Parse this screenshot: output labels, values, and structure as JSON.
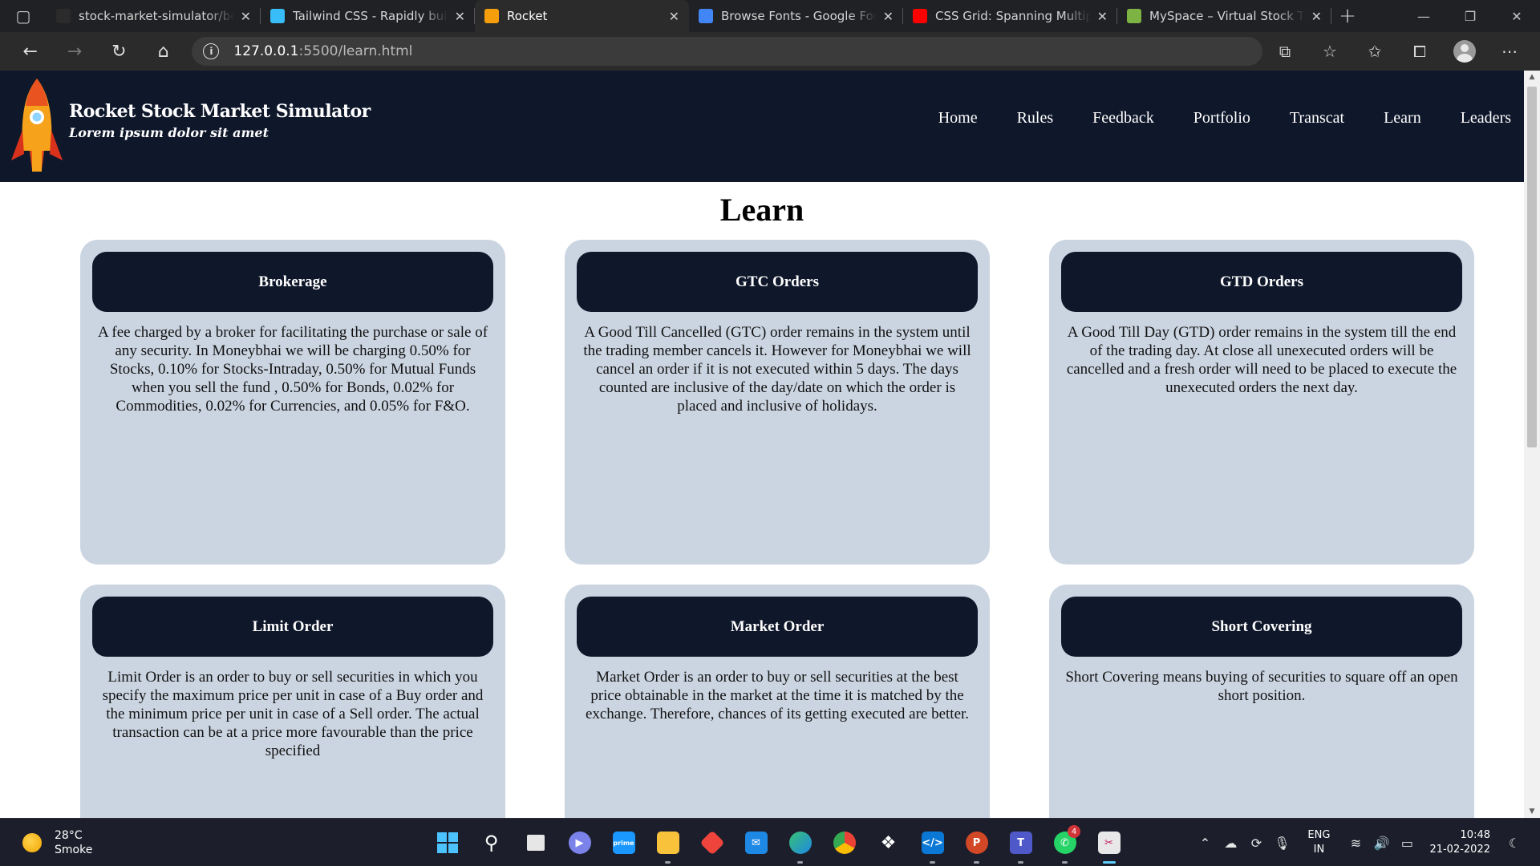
{
  "browser": {
    "tabs": [
      {
        "title": "stock-market-simulator/be",
        "favicon": "github-icon",
        "color": "#2b2b2b",
        "active": false
      },
      {
        "title": "Tailwind CSS - Rapidly build",
        "favicon": "tailwind-icon",
        "color": "#38bdf8",
        "active": false
      },
      {
        "title": "Rocket",
        "favicon": "rocket-icon",
        "color": "#f59e0b",
        "active": true
      },
      {
        "title": "Browse Fonts - Google Font",
        "favicon": "google-fonts-icon",
        "color": "#4285f4",
        "active": false
      },
      {
        "title": "CSS Grid: Spanning Multiple",
        "favicon": "youtube-icon",
        "color": "#ff0000",
        "active": false
      },
      {
        "title": "MySpace – Virtual Stock Tra",
        "favicon": "myspace-icon",
        "color": "#7cb342",
        "active": false
      }
    ],
    "url_host": "127.0.0.1",
    "url_path": ":5500/learn.html"
  },
  "header": {
    "title": "Rocket Stock Market Simulator",
    "subtitle": "Lorem ipsum dolor sit amet",
    "nav": [
      "Home",
      "Rules",
      "Feedback",
      "Portfolio",
      "Transcat",
      "Learn",
      "Leaders"
    ]
  },
  "page": {
    "title": "Learn",
    "cards": [
      {
        "heading": "Brokerage",
        "text": "A fee charged by a broker for facilitating the purchase or sale of any security. In Moneybhai we will be charging 0.50% for Stocks, 0.10% for Stocks-Intraday, 0.50% for Mutual Funds when you sell the fund , 0.50% for Bonds, 0.02% for Commodities, 0.02% for Currencies, and 0.05% for F&O."
      },
      {
        "heading": "GTC Orders",
        "text": "A Good Till Cancelled (GTC) order remains in the system until the trading member cancels it. However for Moneybhai we will cancel an order if it is not executed within 5 days. The days counted are inclusive of the day/date on which the order is placed and inclusive of holidays."
      },
      {
        "heading": "GTD Orders",
        "text": "A Good Till Day (GTD) order remains in the system till the end of the trading day. At close all unexecuted orders will be cancelled and a fresh order will need to be placed to execute the unexecuted orders the next day."
      },
      {
        "heading": "Limit Order",
        "text": "Limit Order is an order to buy or sell securities in which you specify the maximum price per unit in case of a Buy order and the minimum price per unit in case of a Sell order. The actual transaction can be at a price more favourable than the price specified"
      },
      {
        "heading": "Market Order",
        "text": "Market Order is an order to buy or sell securities at the best price obtainable in the market at the time it is matched by the exchange. Therefore, chances of its getting executed are better."
      },
      {
        "heading": "Short Covering",
        "text": "Short Covering means buying of securities to square off an open short position."
      }
    ]
  },
  "taskbar": {
    "temperature": "28°C",
    "weather": "Smoke",
    "language": "ENG",
    "region": "IN",
    "time": "10:48",
    "date": "21-02-2022",
    "whatsapp_badge": "4"
  },
  "colors": {
    "navy": "#0f172a",
    "card": "#cbd5e1"
  }
}
